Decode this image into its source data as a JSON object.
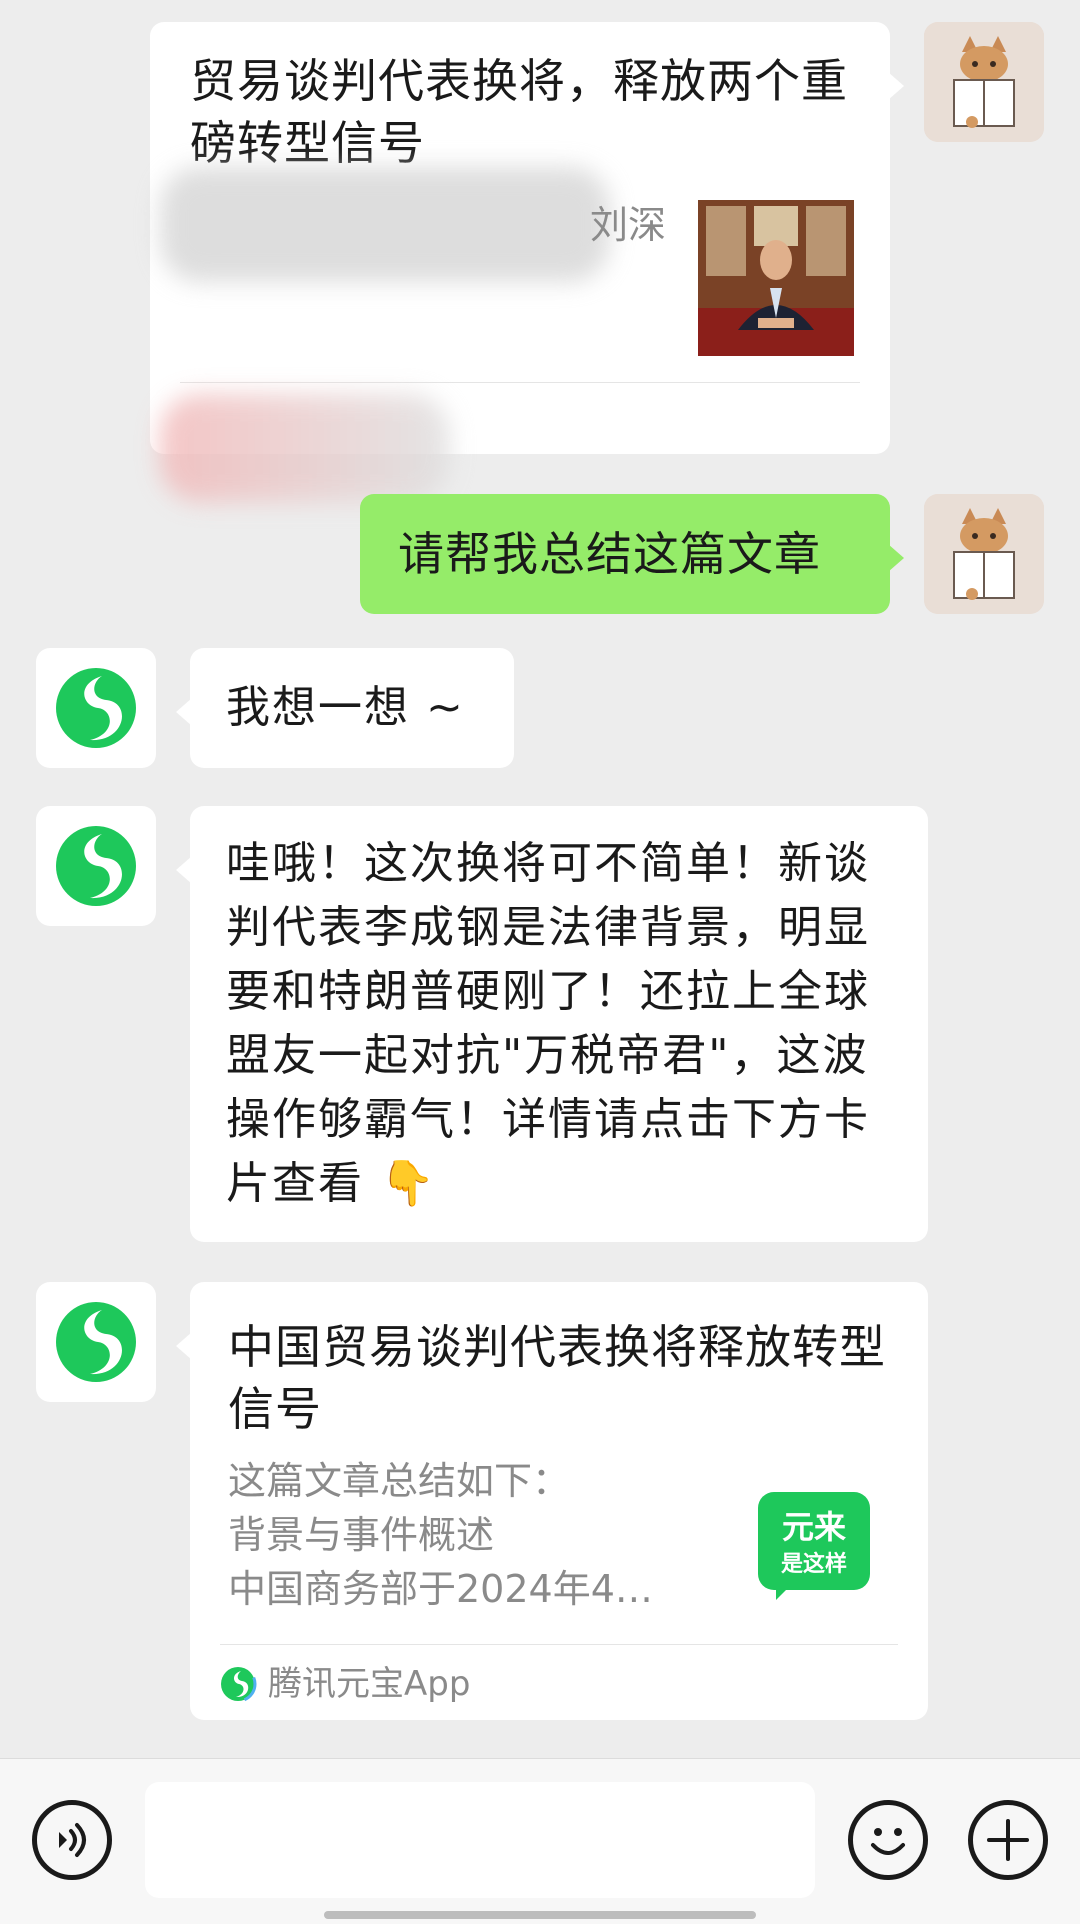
{
  "messages": {
    "shared_article": {
      "title": "贸易谈判代表换将，释放两个重磅转型信号",
      "subtitle_partial": "刘深"
    },
    "user_request": {
      "text": "请帮我总结这篇文章"
    },
    "bot_thinking": {
      "text": "我想一想 ~"
    },
    "bot_reply": {
      "text": "哇哦！这次换将可不简单！新谈判代表李成钢是法律背景，明显要和特朗普硬刚了！还拉上全球盟友一起对抗\"万税帝君\"，这波操作够霸气！详情请点击下方卡片查看 👇"
    },
    "summary_card": {
      "title": "中国贸易谈判代表换将释放转型信号",
      "line1": "这篇文章总结如下：",
      "line2": "背景与事件概述",
      "line3": "中国商务部于2024年4…",
      "thumb_line1": "元来",
      "thumb_line2": "是这样",
      "source": "腾讯元宝App"
    }
  },
  "input_bar": {
    "voice_icon": "voice-icon",
    "emoji_icon": "emoji-icon",
    "plus_icon": "plus-icon"
  },
  "colors": {
    "background": "#ededed",
    "user_bubble": "#95ec69",
    "bot_brand": "#1ec85b"
  }
}
